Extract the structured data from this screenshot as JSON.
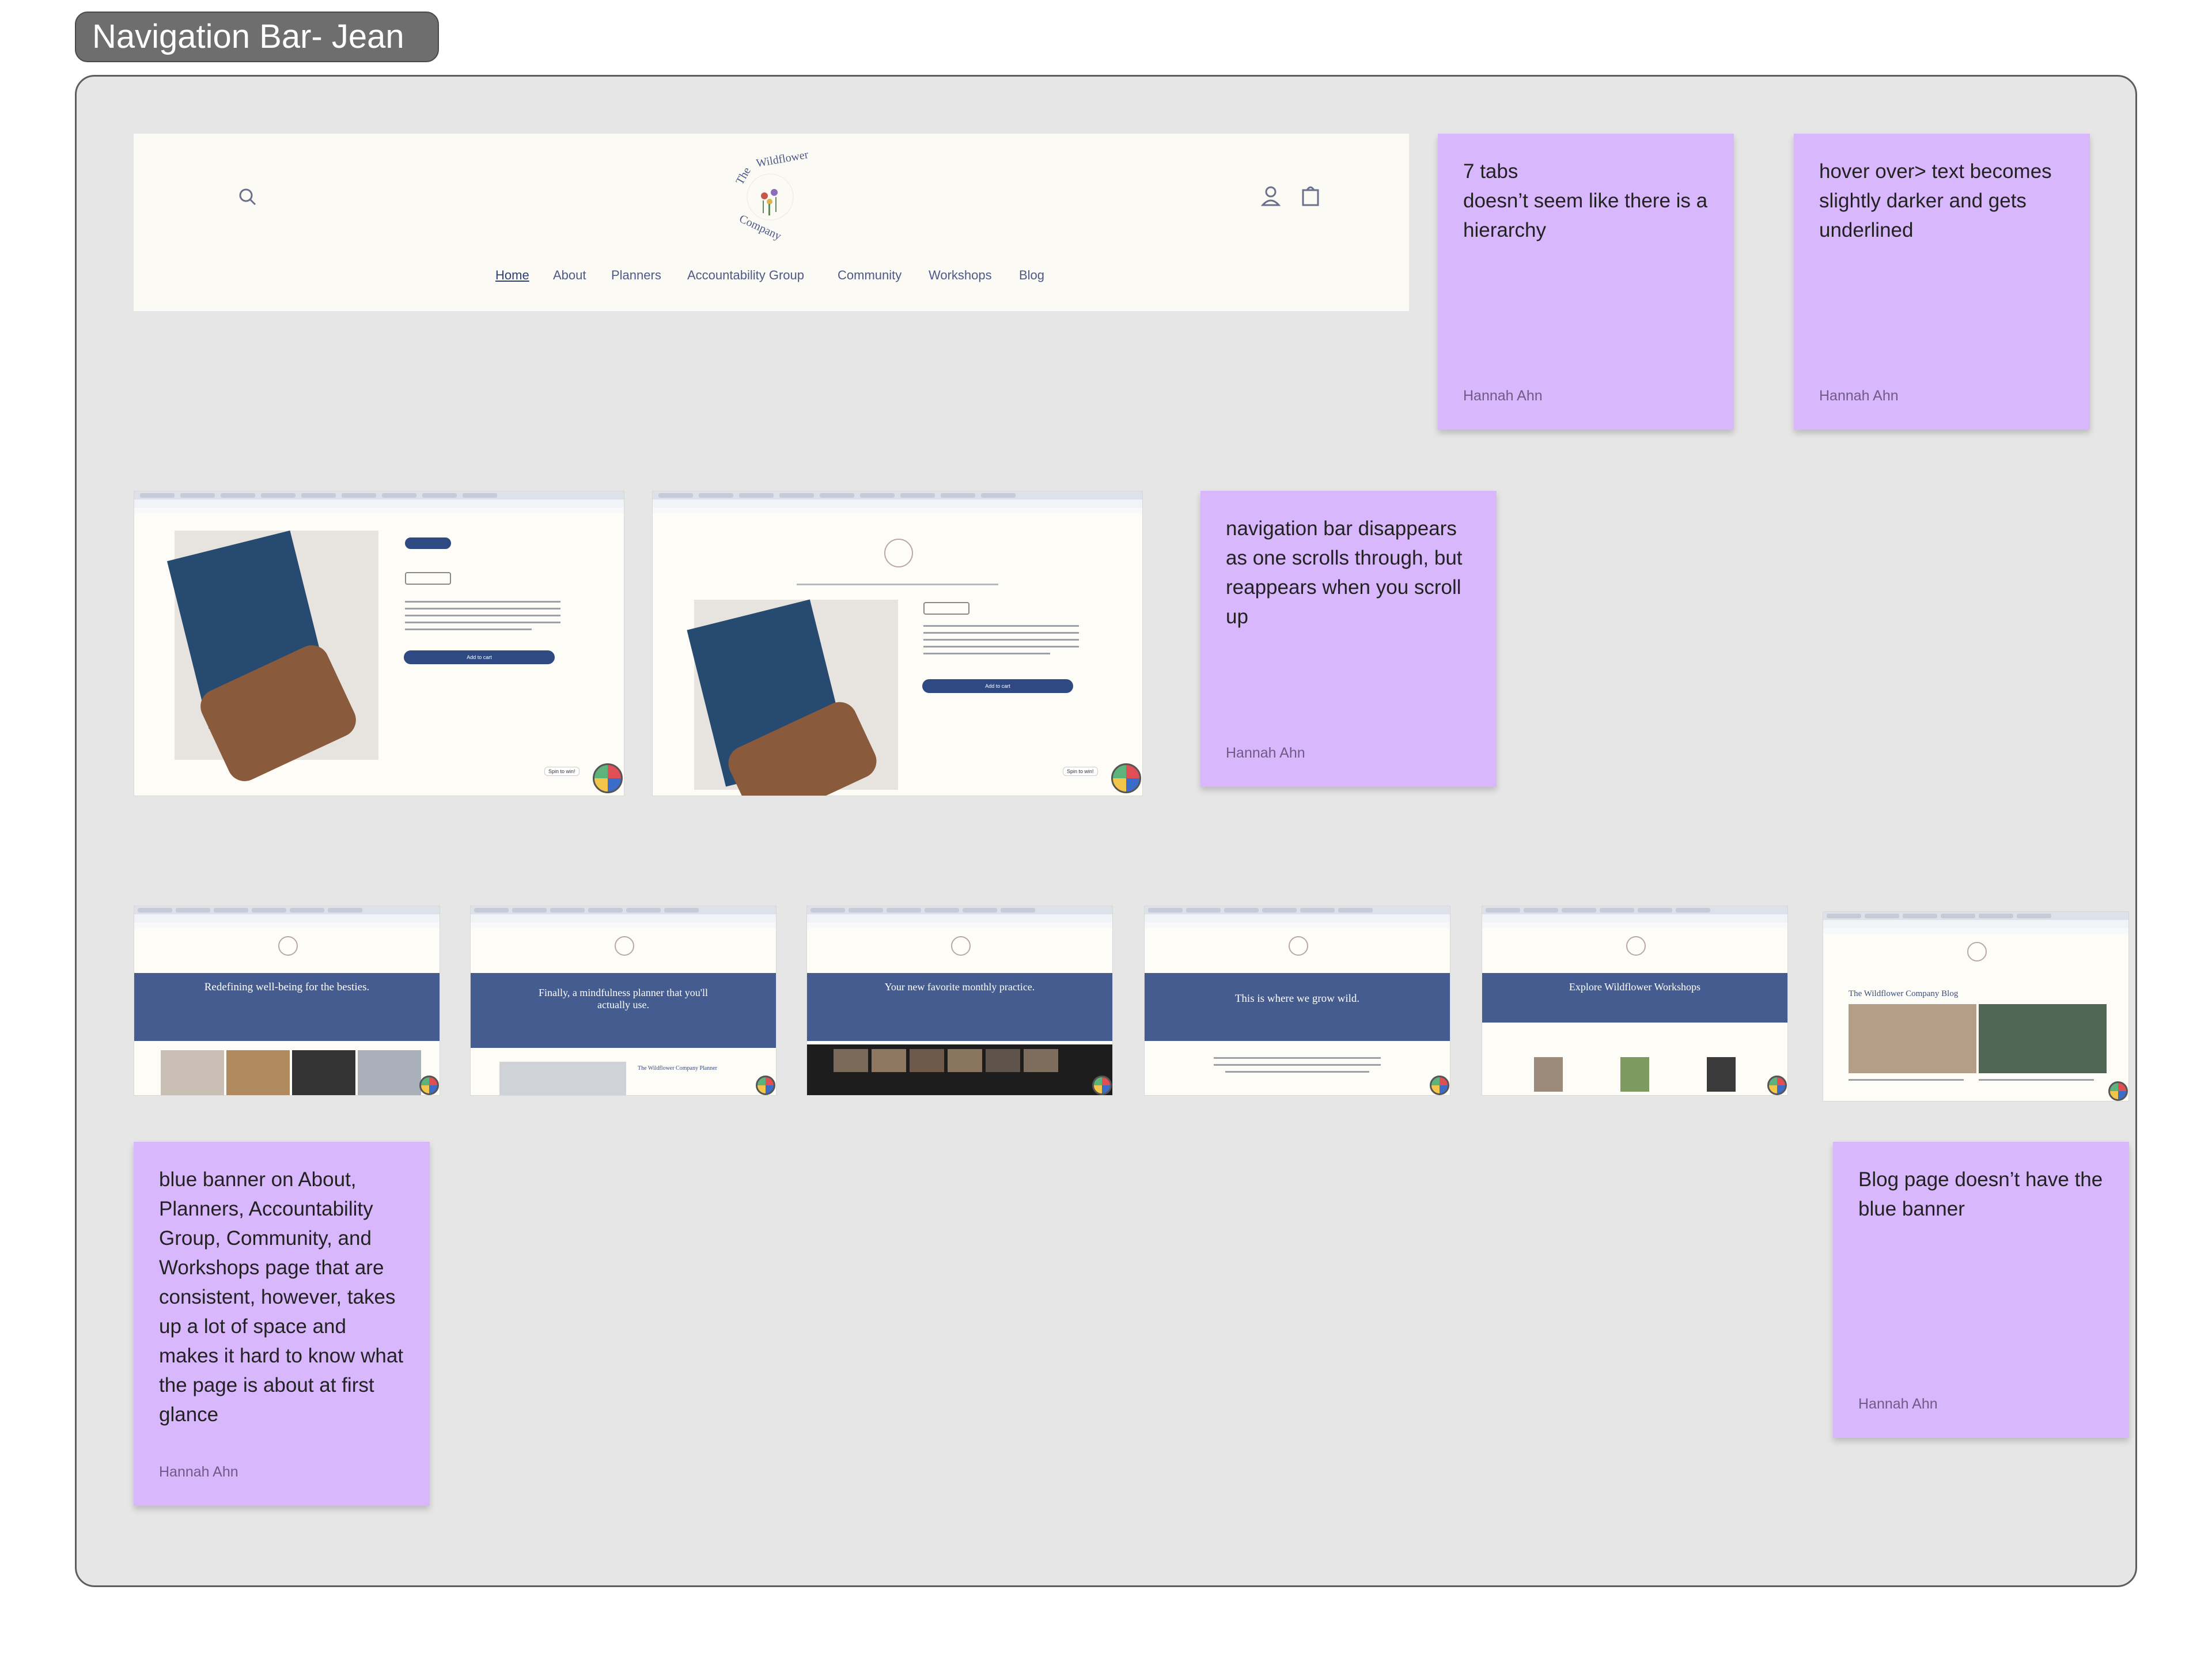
{
  "section": {
    "title": "Navigation Bar- Jean"
  },
  "nav": {
    "logo_text": "The Wildflower Company",
    "links": [
      "Home",
      "About",
      "Planners",
      "Accountability Group",
      "Community",
      "Workshops",
      "Blog"
    ],
    "active": "Home"
  },
  "stickies": {
    "tabs": {
      "text": "7 tabs\ndoesn’t seem like there is a hierarchy",
      "author": "Hannah Ahn"
    },
    "hover": {
      "text": "hover over> text becomes slightly darker and gets underlined",
      "author": "Hannah Ahn"
    },
    "scroll": {
      "text": "navigation bar disappears as one scrolls through, but reappears when you scroll up",
      "author": "Hannah Ahn"
    },
    "banner": {
      "text": "blue banner on About, Planners, Accountability Group, Community, and Workshops page that are consistent, however, takes up a lot of space and makes it hard to know what the page is about at first glance",
      "author": "Hannah Ahn"
    },
    "blog": {
      "text": "Blog page doesn’t have the blue banner",
      "author": "Hannah Ahn"
    }
  },
  "product_pages": {
    "add_to_cart": "Add to cart",
    "spin": "Spin to win!",
    "book_title": "The Wildflower Company Planner"
  },
  "page_thumbs": [
    {
      "banner": "Redefining well-being for the besties."
    },
    {
      "banner": "Finally, a mindfulness planner that you'll actually use."
    },
    {
      "banner": "Your new favorite monthly practice."
    },
    {
      "banner": "This is where we grow wild."
    },
    {
      "banner": "Explore Wildflower Workshops"
    },
    {
      "banner": "The Wildflower Company Blog"
    }
  ],
  "colors": {
    "sticky": "#d8b7fc",
    "banner": "#445c90",
    "nav_link": "#4d5a88"
  }
}
